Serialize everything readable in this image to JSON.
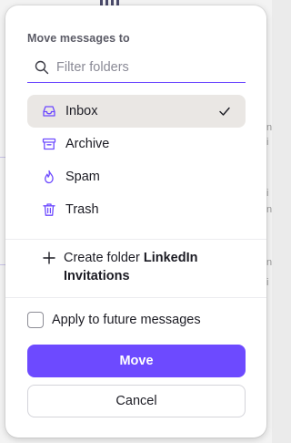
{
  "move_panel": {
    "heading": "Move messages to",
    "filter": {
      "placeholder": "Filter folders",
      "value": ""
    },
    "folders": [
      {
        "label": "Inbox",
        "icon": "inbox-icon",
        "selected": true
      },
      {
        "label": "Archive",
        "icon": "archive-icon",
        "selected": false
      },
      {
        "label": "Spam",
        "icon": "spam-icon",
        "selected": false
      },
      {
        "label": "Trash",
        "icon": "trash-icon",
        "selected": false
      }
    ],
    "create_folder": {
      "prefix": "Create folder",
      "name": "LinkedIn Invitations"
    },
    "apply_future": {
      "label": "Apply to future messages",
      "checked": false
    },
    "buttons": {
      "move": "Move",
      "cancel": "Cancel"
    }
  },
  "colors": {
    "accent": "#6d4aff",
    "selected_bg": "#eae7e4",
    "text": "#1c1c24",
    "muted": "#5b5b66"
  }
}
